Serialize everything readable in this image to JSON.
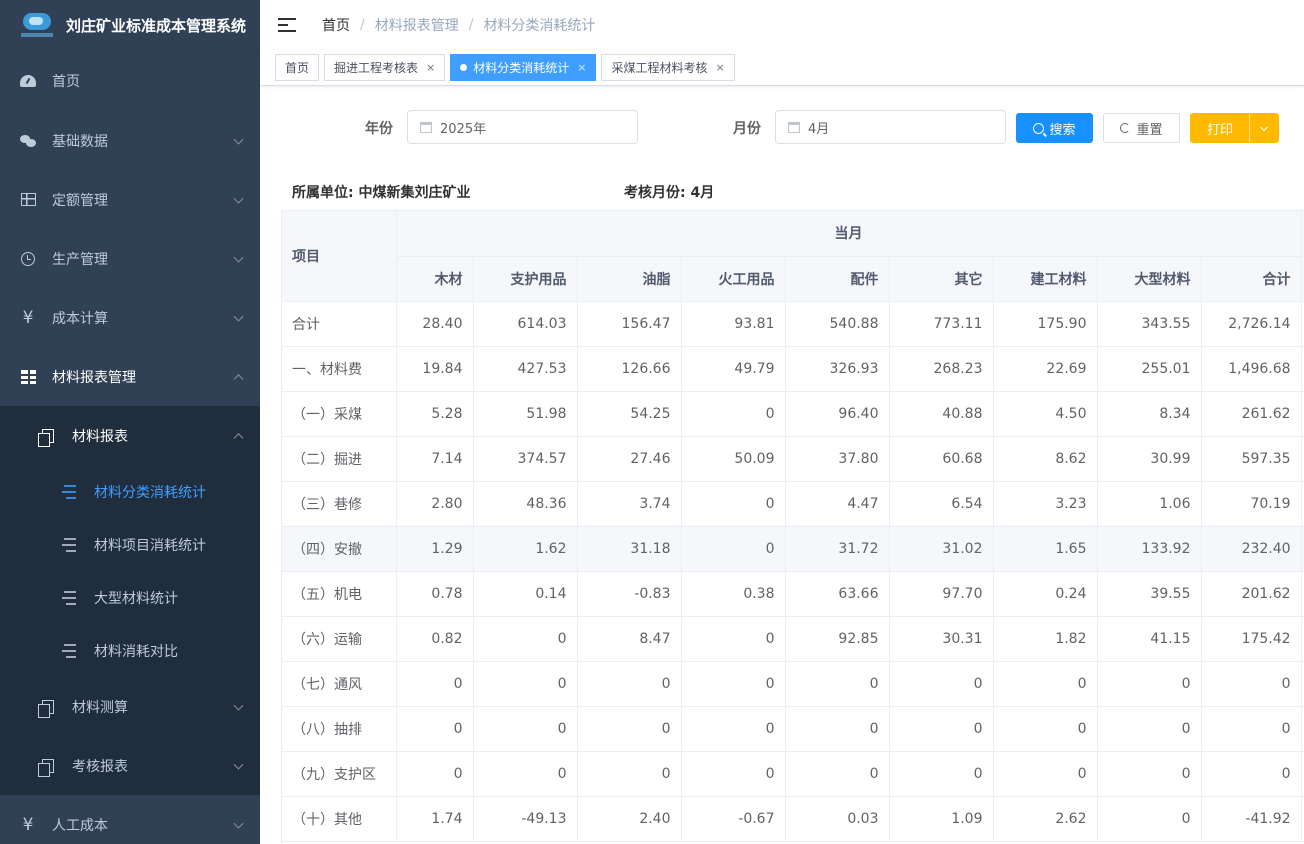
{
  "app": {
    "title": "刘庄矿业标准成本管理系统"
  },
  "sidebar": {
    "menu": [
      {
        "label": "首页",
        "icon": "dashboard-icon"
      },
      {
        "label": "基础数据",
        "icon": "chat-icon"
      },
      {
        "label": "定额管理",
        "icon": "table-icon"
      },
      {
        "label": "生产管理",
        "icon": "clock-icon"
      },
      {
        "label": "成本计算",
        "icon": "yen-icon"
      },
      {
        "label": "材料报表管理",
        "icon": "grid-icon"
      }
    ],
    "sub": [
      {
        "label": "材料报表"
      },
      {
        "label": "材料测算"
      },
      {
        "label": "考核报表"
      }
    ],
    "leaves": [
      {
        "label": "材料分类消耗统计"
      },
      {
        "label": "材料项目消耗统计"
      },
      {
        "label": "大型材料统计"
      },
      {
        "label": "材料消耗对比"
      }
    ],
    "bottom": {
      "label": "人工成本"
    }
  },
  "breadcrumb": [
    "首页",
    "材料报表管理",
    "材料分类消耗统计"
  ],
  "tabs": [
    {
      "label": "首页"
    },
    {
      "label": "掘进工程考核表"
    },
    {
      "label": "材料分类消耗统计"
    },
    {
      "label": "采煤工程材料考核"
    }
  ],
  "tab_close": "×",
  "filters": {
    "year_label": "年份",
    "year_value": "2025年",
    "month_label": "月份",
    "month_value": "4月",
    "search_label": "搜索",
    "reset_label": "重置",
    "print_label": "打印"
  },
  "info": {
    "unit": "所属单位: 中煤新集刘庄矿业",
    "month": "考核月份: 4月"
  },
  "table": {
    "project_header": "项目",
    "group_header": "当月",
    "columns": [
      "木材",
      "支护用品",
      "油脂",
      "火工用品",
      "配件",
      "其它",
      "建工材料",
      "大型材料",
      "合计"
    ],
    "rows": [
      {
        "name": "合计",
        "values": [
          "28.40",
          "614.03",
          "156.47",
          "93.81",
          "540.88",
          "773.11",
          "175.90",
          "343.55",
          "2,726.14"
        ]
      },
      {
        "name": "一、材料费",
        "values": [
          "19.84",
          "427.53",
          "126.66",
          "49.79",
          "326.93",
          "268.23",
          "22.69",
          "255.01",
          "1,496.68"
        ]
      },
      {
        "name": "（一）采煤",
        "values": [
          "5.28",
          "51.98",
          "54.25",
          "0",
          "96.40",
          "40.88",
          "4.50",
          "8.34",
          "261.62"
        ]
      },
      {
        "name": "（二）掘进",
        "values": [
          "7.14",
          "374.57",
          "27.46",
          "50.09",
          "37.80",
          "60.68",
          "8.62",
          "30.99",
          "597.35"
        ]
      },
      {
        "name": "（三）巷修",
        "values": [
          "2.80",
          "48.36",
          "3.74",
          "0",
          "4.47",
          "6.54",
          "3.23",
          "1.06",
          "70.19"
        ]
      },
      {
        "name": "（四）安撤",
        "values": [
          "1.29",
          "1.62",
          "31.18",
          "0",
          "31.72",
          "31.02",
          "1.65",
          "133.92",
          "232.40"
        ]
      },
      {
        "name": "（五）机电",
        "values": [
          "0.78",
          "0.14",
          "-0.83",
          "0.38",
          "63.66",
          "97.70",
          "0.24",
          "39.55",
          "201.62"
        ]
      },
      {
        "name": "（六）运输",
        "values": [
          "0.82",
          "0",
          "8.47",
          "0",
          "92.85",
          "30.31",
          "1.82",
          "41.15",
          "175.42"
        ]
      },
      {
        "name": "（七）通风",
        "values": [
          "0",
          "0",
          "0",
          "0",
          "0",
          "0",
          "0",
          "0",
          "0"
        ]
      },
      {
        "name": "（八）抽排",
        "values": [
          "0",
          "0",
          "0",
          "0",
          "0",
          "0",
          "0",
          "0",
          "0"
        ]
      },
      {
        "name": "（九）支护区",
        "values": [
          "0",
          "0",
          "0",
          "0",
          "0",
          "0",
          "0",
          "0",
          "0"
        ]
      },
      {
        "name": "（十）其他",
        "values": [
          "1.74",
          "-49.13",
          "2.40",
          "-0.67",
          "0.03",
          "1.09",
          "2.62",
          "0",
          "-41.92"
        ]
      }
    ]
  }
}
